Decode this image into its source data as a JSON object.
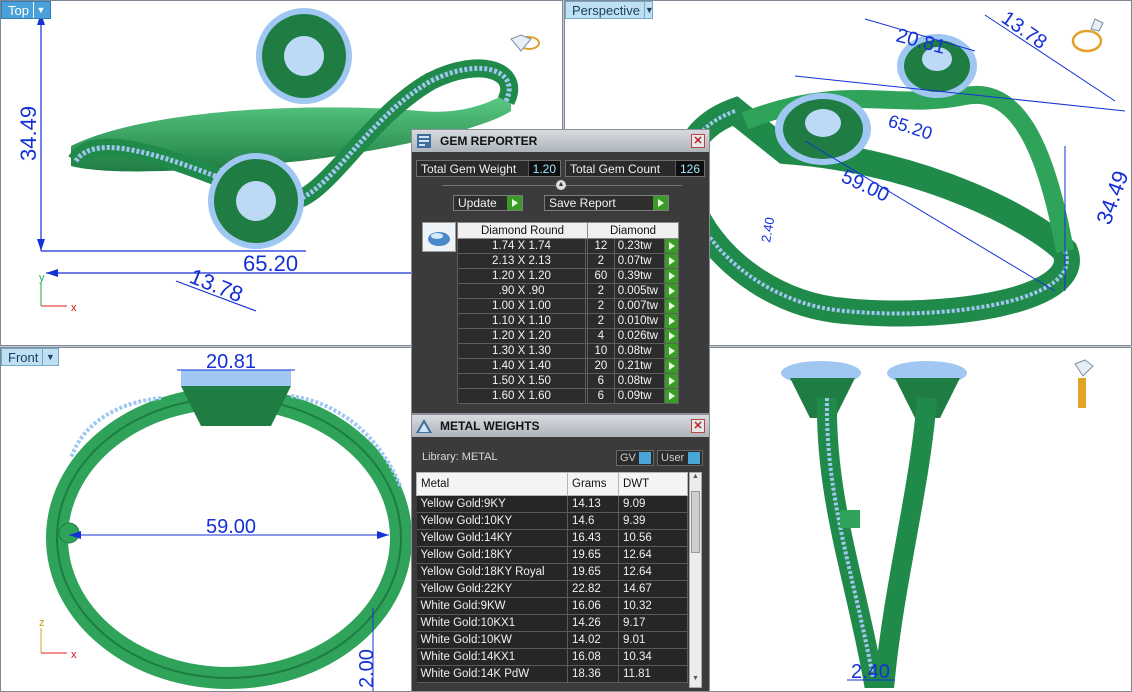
{
  "viewports": {
    "top": {
      "label": "Top",
      "dims": {
        "height": "34.49",
        "width": "65.20",
        "gem": "13.78"
      },
      "axis": {
        "v": "y",
        "h": "x"
      }
    },
    "perspective": {
      "label": "Perspective",
      "dims": {
        "a": "20.81",
        "b": "13.78",
        "c": "65.20",
        "d": "59.00",
        "e": "34.49",
        "f": "2.40"
      }
    },
    "front": {
      "label": "Front",
      "dims": {
        "top": "20.81",
        "mid": "59.00",
        "side": "2.00"
      },
      "axis": {
        "v": "z",
        "h": "x"
      }
    },
    "right": {
      "dims": {
        "bottom": "2.40"
      }
    }
  },
  "gem_reporter": {
    "title": "GEM REPORTER",
    "total_weight_label": "Total Gem Weight",
    "total_weight_value": "1.20",
    "total_count_label": "Total Gem Count",
    "total_count_value": "126",
    "update_label": "Update",
    "save_label": "Save Report",
    "col_shape": "Diamond Round",
    "col_type": "Diamond",
    "rows": [
      {
        "size": "1.74 X 1.74",
        "count": "12",
        "weight": "0.23tw"
      },
      {
        "size": "2.13 X 2.13",
        "count": "2",
        "weight": "0.07tw"
      },
      {
        "size": "1.20 X 1.20",
        "count": "60",
        "weight": "0.39tw"
      },
      {
        "size": ".90 X .90",
        "count": "2",
        "weight": "0.005tw"
      },
      {
        "size": "1.00 X 1.00",
        "count": "2",
        "weight": "0.007tw"
      },
      {
        "size": "1.10 X 1.10",
        "count": "2",
        "weight": "0.010tw"
      },
      {
        "size": "1.20 X 1.20",
        "count": "4",
        "weight": "0.026tw"
      },
      {
        "size": "1.30 X 1.30",
        "count": "10",
        "weight": "0.08tw"
      },
      {
        "size": "1.40 X 1.40",
        "count": "20",
        "weight": "0.21tw"
      },
      {
        "size": "1.50 X 1.50",
        "count": "6",
        "weight": "0.08tw"
      },
      {
        "size": "1.60 X 1.60",
        "count": "6",
        "weight": "0.09tw"
      }
    ]
  },
  "metal_weights": {
    "title": "METAL WEIGHTS",
    "library_label": "Library: METAL",
    "gv_label": "GV",
    "user_label": "User",
    "col_metal": "Metal",
    "col_grams": "Grams",
    "col_dwt": "DWT",
    "rows": [
      {
        "metal": "Yellow Gold:9KY",
        "grams": "14.13",
        "dwt": "9.09"
      },
      {
        "metal": "Yellow Gold:10KY",
        "grams": "14.6",
        "dwt": "9.39"
      },
      {
        "metal": "Yellow Gold:14KY",
        "grams": "16.43",
        "dwt": "10.56"
      },
      {
        "metal": "Yellow Gold:18KY",
        "grams": "19.65",
        "dwt": "12.64"
      },
      {
        "metal": "Yellow Gold:18KY Royal",
        "grams": "19.65",
        "dwt": "12.64"
      },
      {
        "metal": "Yellow Gold:22KY",
        "grams": "22.82",
        "dwt": "14.67"
      },
      {
        "metal": "White Gold:9KW",
        "grams": "16.06",
        "dwt": "10.32"
      },
      {
        "metal": "White Gold:10KX1",
        "grams": "14.26",
        "dwt": "9.17"
      },
      {
        "metal": "White Gold:10KW",
        "grams": "14.02",
        "dwt": "9.01"
      },
      {
        "metal": "White Gold:14KX1",
        "grams": "16.08",
        "dwt": "10.34"
      },
      {
        "metal": "White Gold:14K PdW",
        "grams": "18.36",
        "dwt": "11.81"
      }
    ]
  },
  "colors": {
    "dimension": "#1431d6",
    "metal": "#2fa35a",
    "stone": "#9fc7f2",
    "ok": "#3c9a2b"
  }
}
